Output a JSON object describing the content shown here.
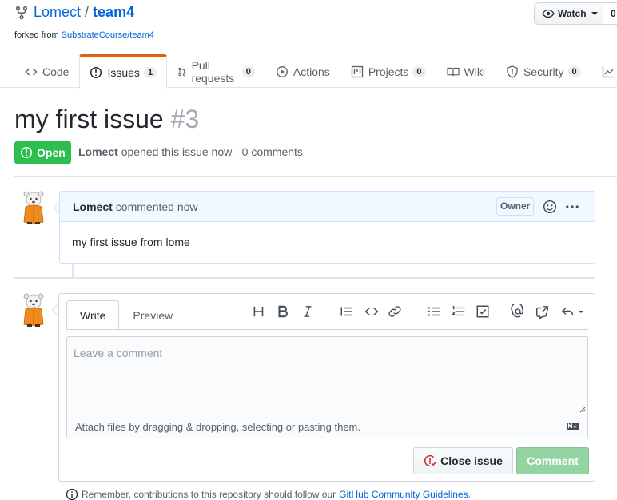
{
  "repo": {
    "owner": "Lomect",
    "separator": "/",
    "name": "team4",
    "forked_prefix": "forked from",
    "forked_source": "SubstrateCourse/team4"
  },
  "watch": {
    "label": "Watch",
    "count": "0"
  },
  "tabs": [
    {
      "label": "Code",
      "icon": "code-icon"
    },
    {
      "label": "Issues",
      "counter": "1",
      "icon": "issue-opened-icon"
    },
    {
      "label": "Pull requests",
      "counter": "0",
      "icon": "git-pull-request-icon"
    },
    {
      "label": "Actions",
      "icon": "play-icon"
    },
    {
      "label": "Projects",
      "counter": "0",
      "icon": "project-icon"
    },
    {
      "label": "Wiki",
      "icon": "book-icon"
    },
    {
      "label": "Security",
      "counter": "0",
      "icon": "shield-icon"
    }
  ],
  "issue": {
    "title": "my first issue",
    "number": "#3",
    "state": "Open",
    "author": "Lomect",
    "meta_text": "opened this issue now · 0 comments"
  },
  "comment": {
    "author": "Lomect",
    "action": "commented now",
    "role_badge": "Owner",
    "body": "my first issue from lome"
  },
  "editor": {
    "tab_write": "Write",
    "tab_preview": "Preview",
    "placeholder": "Leave a comment",
    "attach_text": "Attach files by dragging & dropping, selecting or pasting them.",
    "close_button": "Close issue",
    "comment_button": "Comment"
  },
  "footer": {
    "text": "Remember, contributions to this repository should follow our",
    "link": "GitHub Community Guidelines",
    "suffix": "."
  },
  "colors": {
    "link": "#0366d6",
    "open_green": "#2cbe4e",
    "tab_accent": "#e36209",
    "comment_disabled": "#94d3a2",
    "close_icon_red": "#cb2431"
  }
}
